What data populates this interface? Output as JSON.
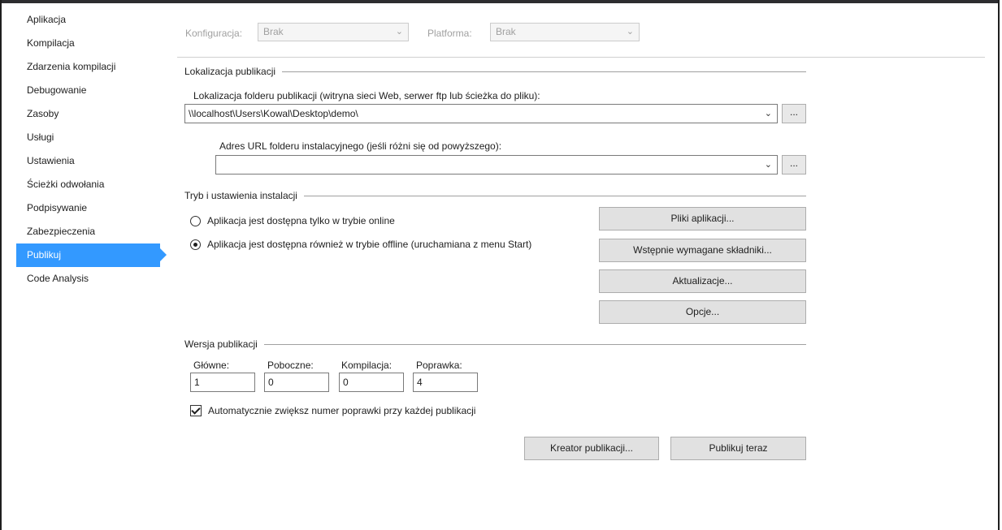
{
  "sidebar": {
    "items": [
      {
        "label": "Aplikacja"
      },
      {
        "label": "Kompilacja"
      },
      {
        "label": "Zdarzenia kompilacji"
      },
      {
        "label": "Debugowanie"
      },
      {
        "label": "Zasoby"
      },
      {
        "label": "Usługi"
      },
      {
        "label": "Ustawienia"
      },
      {
        "label": "Ścieżki odwołania"
      },
      {
        "label": "Podpisywanie"
      },
      {
        "label": "Zabezpieczenia"
      },
      {
        "label": "Publikuj",
        "active": true
      },
      {
        "label": "Code Analysis"
      }
    ]
  },
  "config": {
    "configuration_label": "Konfiguracja:",
    "configuration_value": "Brak",
    "platform_label": "Platforma:",
    "platform_value": "Brak"
  },
  "publish_location": {
    "group_title": "Lokalizacja publikacji",
    "folder_label": "Lokalizacja folderu publikacji (witryna sieci Web, serwer ftp lub ścieżka do pliku):",
    "folder_value": "\\\\localhost\\Users\\Kowal\\Desktop\\demo\\",
    "install_url_label": "Adres URL folderu instalacyjnego (jeśli różni się od powyższego):",
    "install_url_value": "",
    "browse_label": "..."
  },
  "install_mode": {
    "group_title": "Tryb i ustawienia instalacji",
    "online_only_label": "Aplikacja jest dostępna tylko w trybie online",
    "offline_label": "Aplikacja jest dostępna również w trybie offline (uruchamiana z menu Start)",
    "selected": "offline",
    "buttons": {
      "app_files": "Pliki aplikacji...",
      "prerequisites": "Wstępnie wymagane składniki...",
      "updates": "Aktualizacje...",
      "options": "Opcje..."
    }
  },
  "publish_version": {
    "group_title": "Wersja publikacji",
    "major_label": "Główne:",
    "minor_label": "Poboczne:",
    "build_label": "Kompilacja:",
    "revision_label": "Poprawka:",
    "major": "1",
    "minor": "0",
    "build": "0",
    "revision": "4",
    "auto_increment_label": "Automatycznie zwiększ numer poprawki przy każdej publikacji",
    "auto_increment_checked": true
  },
  "actions": {
    "wizard": "Kreator publikacji...",
    "publish_now": "Publikuj teraz"
  }
}
